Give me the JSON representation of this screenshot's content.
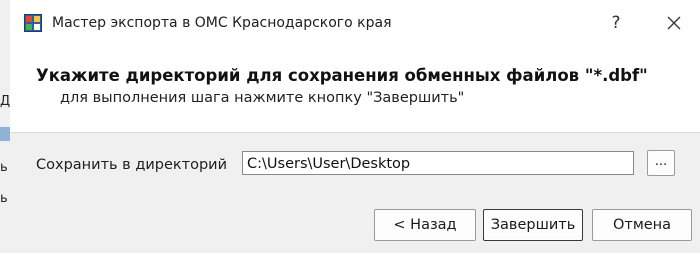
{
  "window": {
    "title": "Мастер экспорта в ОМС Краснодарского края",
    "help_glyph": "?",
    "close_glyph": "✕"
  },
  "header": {
    "heading": "Укажите директорий для сохранения обменных файлов \"*.dbf\"",
    "subheading": "для выполнения шага нажмите кнопку \"Завершить\""
  },
  "form": {
    "directory_label": "Сохранить в директорий",
    "directory_value": "C:\\Users\\User\\Desktop",
    "browse_label": "..."
  },
  "buttons": {
    "back_label": "< Назад",
    "finish_label": "Завершить",
    "cancel_label": "Отмена"
  },
  "background_fragments": [
    "Д",
    "ь",
    "ь"
  ],
  "colors": {
    "body_bg": "#f0f0f0",
    "header_bg": "#ffffff",
    "default_button_border": "#3a3a3a"
  }
}
